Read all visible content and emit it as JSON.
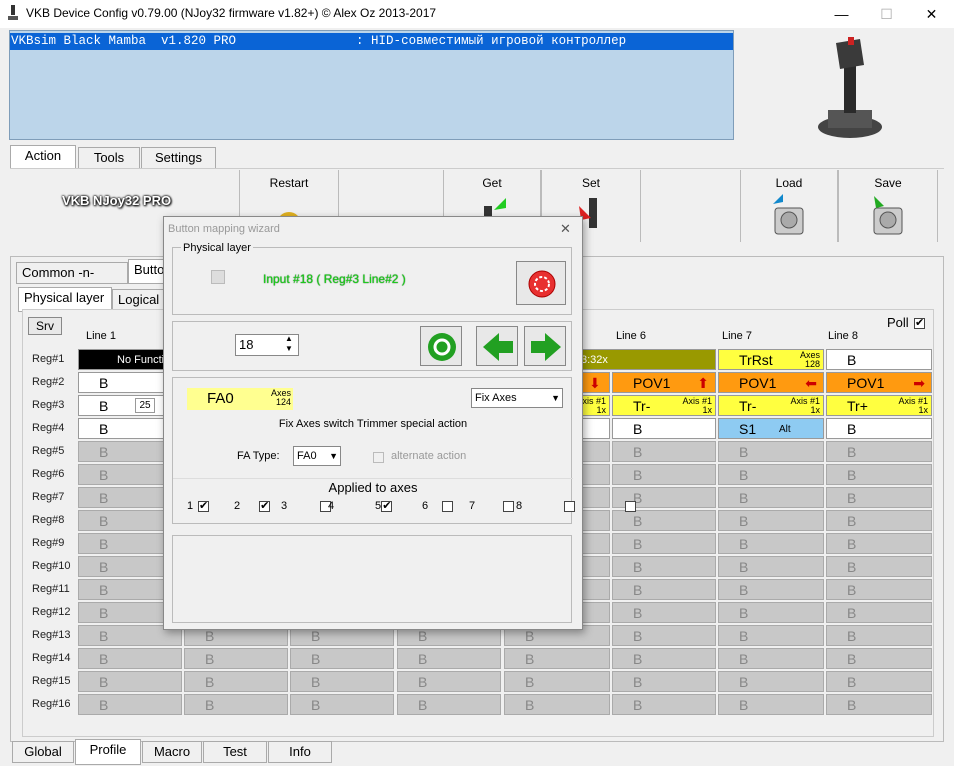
{
  "window": {
    "title": "VKB Device Config v0.79.00 (NJoy32 firmware v1.82+) © Alex Oz 2013-2017",
    "minimize": "—",
    "maximize": "☐",
    "close": "✕"
  },
  "info": {
    "line": "VKBsim Black Mamba  v1.820 PRO                : HID-совместимый игровой контроллер"
  },
  "top_tabs": [
    "Action",
    "Tools",
    "Settings"
  ],
  "toolbar": {
    "device": "VKB NJoy32 PRO",
    "restart": "Restart",
    "get": "Get",
    "set": "Set",
    "load": "Load",
    "save": "Save"
  },
  "panel_tabs": {
    "common": "Common -n- Axes",
    "buttons": "Butto"
  },
  "layer_tabs": {
    "physical": "Physical layer",
    "logical": "Logical"
  },
  "grid": {
    "srv": "Srv",
    "poll": "Poll",
    "lines": [
      "Line 1",
      "Line 6",
      "Line 7",
      "Line 8"
    ],
    "regs": [
      "Reg#1",
      "Reg#2",
      "Reg#3",
      "Reg#4",
      "Reg#5",
      "Reg#6",
      "Reg#7",
      "Reg#8",
      "Reg#9",
      "Reg#10",
      "Reg#11",
      "Reg#12",
      "Reg#13",
      "Reg#14",
      "Reg#15",
      "Reg#16"
    ],
    "b": "B",
    "r1c1": "No Functio",
    "r3c1_badge": "25",
    "r1c5": "3:32x",
    "r1c7": "TrRst",
    "r1c7_axes": "Axes",
    "r1c7_num": "128",
    "r2c6": "POV1",
    "r2c7": "POV1",
    "r2c8": "POV1",
    "r3c6": "Tr-",
    "r3c7": "Tr-",
    "r3c8": "Tr+",
    "axis_small": "Axis #1",
    "axis_x": "1x",
    "r4c7": "S1",
    "r4c7_alt": "Alt"
  },
  "wizard": {
    "title": "Button mapping wizard",
    "close": "✕",
    "physical_layer": "Physical layer",
    "input_text": "Input #18 ( Reg#3  Line#2 )",
    "spin_value": "18",
    "fa_label": "FA0",
    "fa_axes": "Axes",
    "fa_num": "124",
    "type_select": "Fix Axes",
    "description": "Fix Axes switch Trimmer special action",
    "fa_type_label": "FA Type:",
    "fa_type_value": "FA0",
    "alternate": "alternate action",
    "applied": "Applied to axes",
    "axes": [
      {
        "n": "1",
        "on": true
      },
      {
        "n": "2",
        "on": true
      },
      {
        "n": "3",
        "on": false
      },
      {
        "n": "4",
        "on": true
      },
      {
        "n": "5",
        "on": false
      },
      {
        "n": "6",
        "on": false
      },
      {
        "n": "7",
        "on": false
      },
      {
        "n": "8",
        "on": false
      }
    ]
  },
  "bottom_tabs": [
    "Global",
    "Profile",
    "Macro",
    "Test",
    "Info"
  ]
}
